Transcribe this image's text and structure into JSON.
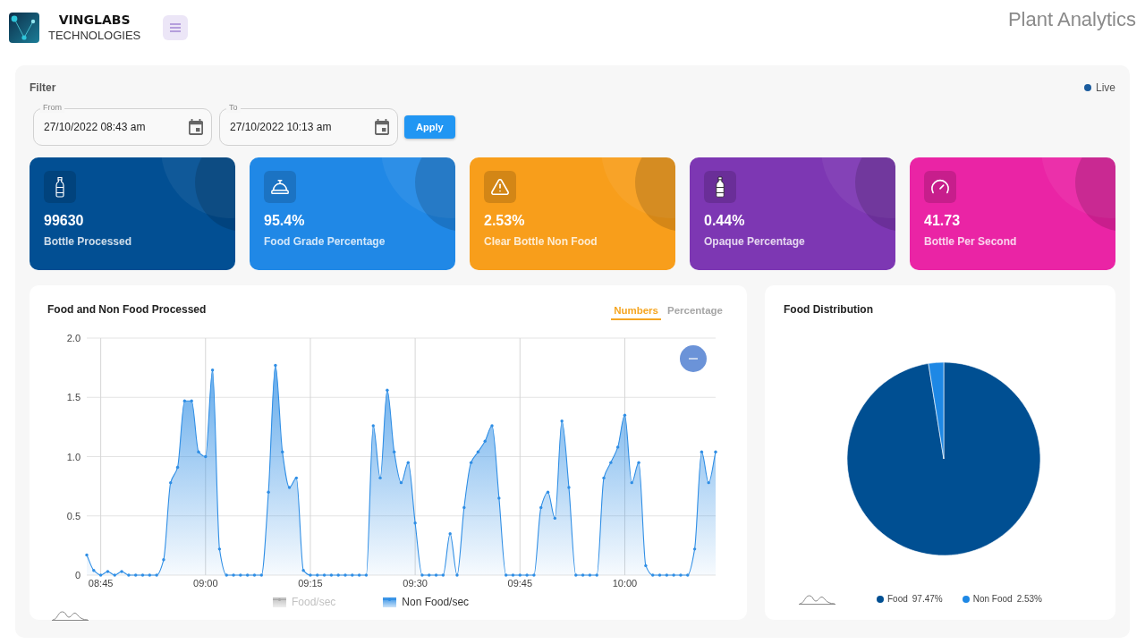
{
  "header": {
    "logo_title": "VINGLABS",
    "logo_subtitle": "TECHNOLOGIES",
    "page_title": "Plant Analytics"
  },
  "filter": {
    "title": "Filter",
    "live": {
      "label": "Live",
      "on": true
    },
    "fields": [
      {
        "label": "From",
        "value": "27/10/2022 08:43 am"
      },
      {
        "label": "To",
        "value": "27/10/2022 10:13 am"
      }
    ],
    "apply_button": "Apply"
  },
  "stat_cards": [
    {
      "kind": "bottle",
      "value": "99630",
      "label": "Bottle Processed",
      "color": "#024f93"
    },
    {
      "kind": "cloche",
      "value": "95.4%",
      "label": "Food Grade Percentage",
      "color": "#2088e6"
    },
    {
      "kind": "warning",
      "value": "2.53%",
      "label": "Clear Bottle Non Food",
      "color": "#f89e1b"
    },
    {
      "kind": "bottle-solid",
      "value": "0.44%",
      "label": "Opaque Percentage",
      "color": "#7d37b3"
    },
    {
      "kind": "gauge",
      "value": "41.73",
      "label": "Bottle Per Second",
      "color": "#ea24a5"
    }
  ],
  "processed_chart": {
    "title": "Food and Non Food Processed",
    "tabs": [
      {
        "label": "Numbers",
        "selected": true
      },
      {
        "label": "Percentage",
        "selected": false
      }
    ],
    "legend_items": [
      {
        "label": "Food/sec",
        "selected": false
      },
      {
        "label": "Non Food/sec",
        "selected": true
      }
    ],
    "chart_data": {
      "type": "area",
      "grid": true,
      "categories": [
        null,
        null,
        "08:45",
        null,
        null,
        null,
        null,
        null,
        null,
        null,
        null,
        null,
        null,
        null,
        null,
        null,
        null,
        "09:00",
        null,
        null,
        null,
        null,
        null,
        null,
        null,
        null,
        null,
        null,
        null,
        null,
        null,
        null,
        "09:15",
        null,
        null,
        null,
        null,
        null,
        null,
        null,
        null,
        null,
        null,
        null,
        null,
        null,
        null,
        "09:30",
        null,
        null,
        null,
        null,
        null,
        null,
        null,
        null,
        null,
        null,
        null,
        null,
        null,
        null,
        "09:45",
        null,
        null,
        null,
        null,
        null,
        null,
        null,
        null,
        null,
        null,
        null,
        null,
        null,
        null,
        "10:00",
        null,
        null,
        null,
        null,
        null,
        null,
        null,
        null,
        null,
        null,
        null,
        null,
        null
      ],
      "ylim": [
        0,
        2
      ],
      "yticks": [
        {
          "value": 0,
          "label": "0"
        },
        {
          "value": 0.5,
          "label": "0.5"
        },
        {
          "value": 1,
          "label": "1.0"
        },
        {
          "value": 1.5,
          "label": "1.5"
        },
        {
          "value": 2,
          "label": "2.0"
        }
      ],
      "series": [
        {
          "color": "#2f8ee5",
          "values": [
            0.17,
            0.04,
            0,
            0.03,
            0,
            0.03,
            0,
            0,
            0,
            0,
            0,
            0.13,
            0.78,
            0.91,
            1.47,
            1.47,
            1.04,
            1.0,
            1.73,
            0.22,
            0,
            0,
            0,
            0,
            0,
            0,
            0.7,
            1.77,
            1.04,
            0.74,
            0.82,
            0.04,
            0,
            0,
            0,
            0,
            0,
            0,
            0,
            0,
            0,
            1.26,
            0.82,
            1.56,
            1.04,
            0.78,
            0.95,
            0.44,
            0,
            0,
            0,
            0,
            0.35,
            0,
            0.57,
            0.95,
            1.04,
            1.13,
            1.26,
            0.65,
            0,
            0,
            0,
            0,
            0,
            0.57,
            0.7,
            0.48,
            1.3,
            0.74,
            0,
            0,
            0,
            0,
            0.82,
            0.95,
            1.08,
            1.35,
            0.78,
            0.95,
            0.08,
            0,
            0,
            0,
            0,
            0,
            0,
            0.22,
            1.04,
            0.78,
            1.04
          ]
        }
      ]
    }
  },
  "distribution": {
    "title": "Food Distribution",
    "chart_data": {
      "type": "pie",
      "legend": "bottom",
      "categories": [
        "Food",
        "Non Food"
      ],
      "values": [
        97.47,
        2.53
      ],
      "colors": [
        "#004f92",
        "#1e88e5"
      ],
      "value_labels": [
        "97.47%",
        "2.53%"
      ]
    }
  }
}
